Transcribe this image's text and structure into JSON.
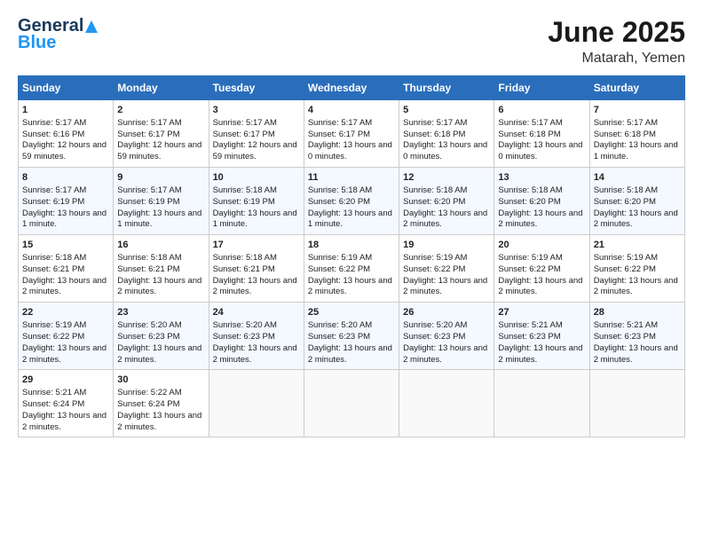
{
  "header": {
    "logo_general": "General",
    "logo_blue": "Blue",
    "title": "June 2025",
    "subtitle": "Matarah, Yemen"
  },
  "days_of_week": [
    "Sunday",
    "Monday",
    "Tuesday",
    "Wednesday",
    "Thursday",
    "Friday",
    "Saturday"
  ],
  "weeks": [
    [
      {
        "day": "1",
        "sunrise": "5:17 AM",
        "sunset": "6:16 PM",
        "daylight": "12 hours and 59 minutes."
      },
      {
        "day": "2",
        "sunrise": "5:17 AM",
        "sunset": "6:17 PM",
        "daylight": "12 hours and 59 minutes."
      },
      {
        "day": "3",
        "sunrise": "5:17 AM",
        "sunset": "6:17 PM",
        "daylight": "12 hours and 59 minutes."
      },
      {
        "day": "4",
        "sunrise": "5:17 AM",
        "sunset": "6:17 PM",
        "daylight": "13 hours and 0 minutes."
      },
      {
        "day": "5",
        "sunrise": "5:17 AM",
        "sunset": "6:18 PM",
        "daylight": "13 hours and 0 minutes."
      },
      {
        "day": "6",
        "sunrise": "5:17 AM",
        "sunset": "6:18 PM",
        "daylight": "13 hours and 0 minutes."
      },
      {
        "day": "7",
        "sunrise": "5:17 AM",
        "sunset": "6:18 PM",
        "daylight": "13 hours and 1 minute."
      }
    ],
    [
      {
        "day": "8",
        "sunrise": "5:17 AM",
        "sunset": "6:19 PM",
        "daylight": "13 hours and 1 minute."
      },
      {
        "day": "9",
        "sunrise": "5:17 AM",
        "sunset": "6:19 PM",
        "daylight": "13 hours and 1 minute."
      },
      {
        "day": "10",
        "sunrise": "5:18 AM",
        "sunset": "6:19 PM",
        "daylight": "13 hours and 1 minute."
      },
      {
        "day": "11",
        "sunrise": "5:18 AM",
        "sunset": "6:20 PM",
        "daylight": "13 hours and 1 minute."
      },
      {
        "day": "12",
        "sunrise": "5:18 AM",
        "sunset": "6:20 PM",
        "daylight": "13 hours and 2 minutes."
      },
      {
        "day": "13",
        "sunrise": "5:18 AM",
        "sunset": "6:20 PM",
        "daylight": "13 hours and 2 minutes."
      },
      {
        "day": "14",
        "sunrise": "5:18 AM",
        "sunset": "6:20 PM",
        "daylight": "13 hours and 2 minutes."
      }
    ],
    [
      {
        "day": "15",
        "sunrise": "5:18 AM",
        "sunset": "6:21 PM",
        "daylight": "13 hours and 2 minutes."
      },
      {
        "day": "16",
        "sunrise": "5:18 AM",
        "sunset": "6:21 PM",
        "daylight": "13 hours and 2 minutes."
      },
      {
        "day": "17",
        "sunrise": "5:18 AM",
        "sunset": "6:21 PM",
        "daylight": "13 hours and 2 minutes."
      },
      {
        "day": "18",
        "sunrise": "5:19 AM",
        "sunset": "6:22 PM",
        "daylight": "13 hours and 2 minutes."
      },
      {
        "day": "19",
        "sunrise": "5:19 AM",
        "sunset": "6:22 PM",
        "daylight": "13 hours and 2 minutes."
      },
      {
        "day": "20",
        "sunrise": "5:19 AM",
        "sunset": "6:22 PM",
        "daylight": "13 hours and 2 minutes."
      },
      {
        "day": "21",
        "sunrise": "5:19 AM",
        "sunset": "6:22 PM",
        "daylight": "13 hours and 2 minutes."
      }
    ],
    [
      {
        "day": "22",
        "sunrise": "5:19 AM",
        "sunset": "6:22 PM",
        "daylight": "13 hours and 2 minutes."
      },
      {
        "day": "23",
        "sunrise": "5:20 AM",
        "sunset": "6:23 PM",
        "daylight": "13 hours and 2 minutes."
      },
      {
        "day": "24",
        "sunrise": "5:20 AM",
        "sunset": "6:23 PM",
        "daylight": "13 hours and 2 minutes."
      },
      {
        "day": "25",
        "sunrise": "5:20 AM",
        "sunset": "6:23 PM",
        "daylight": "13 hours and 2 minutes."
      },
      {
        "day": "26",
        "sunrise": "5:20 AM",
        "sunset": "6:23 PM",
        "daylight": "13 hours and 2 minutes."
      },
      {
        "day": "27",
        "sunrise": "5:21 AM",
        "sunset": "6:23 PM",
        "daylight": "13 hours and 2 minutes."
      },
      {
        "day": "28",
        "sunrise": "5:21 AM",
        "sunset": "6:23 PM",
        "daylight": "13 hours and 2 minutes."
      }
    ],
    [
      {
        "day": "29",
        "sunrise": "5:21 AM",
        "sunset": "6:24 PM",
        "daylight": "13 hours and 2 minutes."
      },
      {
        "day": "30",
        "sunrise": "5:22 AM",
        "sunset": "6:24 PM",
        "daylight": "13 hours and 2 minutes."
      },
      null,
      null,
      null,
      null,
      null
    ]
  ]
}
